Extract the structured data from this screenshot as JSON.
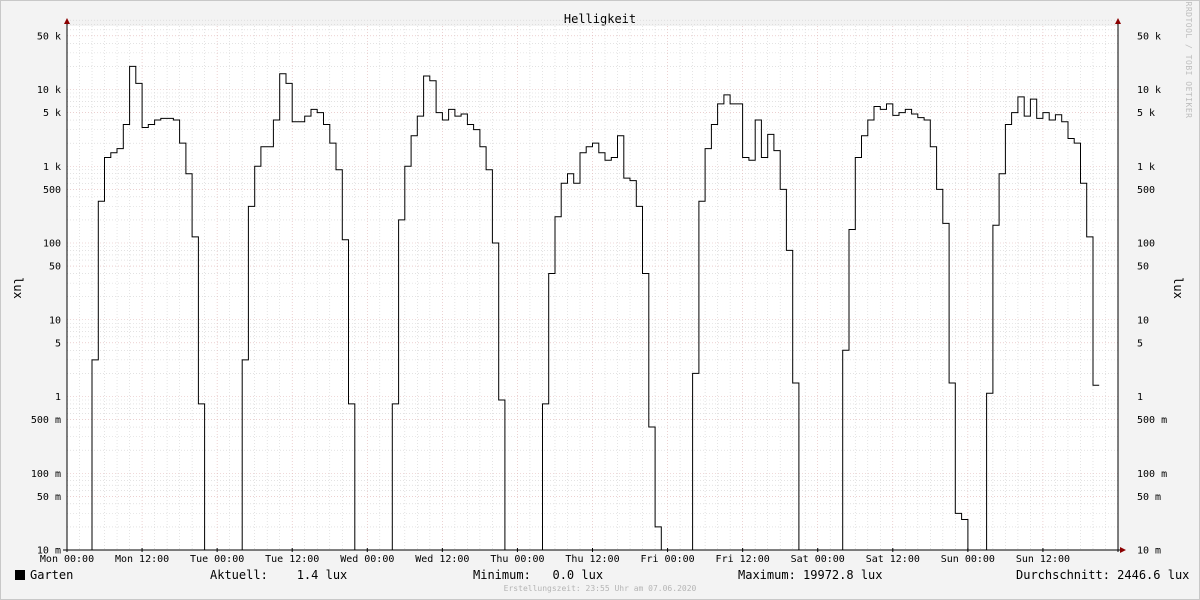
{
  "chart_data": {
    "type": "line",
    "title": "Helligkeit",
    "ylabel": "lux",
    "yscale": "log",
    "ylim": [
      0.01,
      80000
    ],
    "grid": true,
    "y_ticks": [
      {
        "value": 50000,
        "label": "50 k"
      },
      {
        "value": 10000,
        "label": "10 k"
      },
      {
        "value": 5000,
        "label": "5 k"
      },
      {
        "value": 1000,
        "label": "1 k"
      },
      {
        "value": 500,
        "label": "500"
      },
      {
        "value": 100,
        "label": "100"
      },
      {
        "value": 50,
        "label": "50"
      },
      {
        "value": 10,
        "label": "10"
      },
      {
        "value": 5,
        "label": "5"
      },
      {
        "value": 1,
        "label": "1"
      },
      {
        "value": 0.5,
        "label": "500 m"
      },
      {
        "value": 0.1,
        "label": "100 m"
      },
      {
        "value": 0.05,
        "label": "50 m"
      },
      {
        "value": 0.01,
        "label": "10 m"
      }
    ],
    "x_ticks": [
      "Mon 00:00",
      "Mon 12:00",
      "Tue 00:00",
      "Tue 12:00",
      "Wed 00:00",
      "Wed 12:00",
      "Thu 00:00",
      "Thu 12:00",
      "Fri 00:00",
      "Fri 12:00",
      "Sat 00:00",
      "Sat 12:00",
      "Sun 00:00",
      "Sun 12:00"
    ],
    "x_unit": "hours since Mon 00:00",
    "xlim": [
      0,
      168
    ],
    "series": [
      {
        "name": "Garten",
        "color": "#000000",
        "points": [
          [
            0,
            0.01
          ],
          [
            2,
            0.01
          ],
          [
            4,
            0.01
          ],
          [
            4,
            3
          ],
          [
            5,
            3
          ],
          [
            5,
            350
          ],
          [
            6,
            350
          ],
          [
            6,
            1300
          ],
          [
            7,
            1300
          ],
          [
            7,
            1500
          ],
          [
            8,
            1500
          ],
          [
            8,
            1700
          ],
          [
            9,
            1700
          ],
          [
            9,
            3500
          ],
          [
            10,
            3500
          ],
          [
            10,
            20000
          ],
          [
            11,
            20000
          ],
          [
            11,
            12000
          ],
          [
            12,
            12000
          ],
          [
            12,
            3200
          ],
          [
            13,
            3200
          ],
          [
            13,
            3500
          ],
          [
            14,
            3500
          ],
          [
            14,
            4000
          ],
          [
            15,
            4000
          ],
          [
            15,
            4200
          ],
          [
            17,
            4200
          ],
          [
            17,
            4000
          ],
          [
            18,
            4000
          ],
          [
            18,
            2000
          ],
          [
            19,
            2000
          ],
          [
            19,
            800
          ],
          [
            20,
            800
          ],
          [
            20,
            120
          ],
          [
            21,
            120
          ],
          [
            21,
            0.8
          ],
          [
            22,
            0.8
          ],
          [
            22,
            0.01
          ],
          [
            26,
            0.01
          ],
          [
            28,
            0.01
          ],
          [
            28,
            3
          ],
          [
            29,
            3
          ],
          [
            29,
            300
          ],
          [
            30,
            300
          ],
          [
            30,
            1000
          ],
          [
            31,
            1000
          ],
          [
            31,
            1800
          ],
          [
            33,
            1800
          ],
          [
            33,
            4000
          ],
          [
            34,
            4000
          ],
          [
            34,
            16000
          ],
          [
            35,
            16000
          ],
          [
            35,
            12000
          ],
          [
            36,
            12000
          ],
          [
            36,
            3800
          ],
          [
            38,
            3800
          ],
          [
            38,
            4500
          ],
          [
            39,
            4500
          ],
          [
            39,
            5500
          ],
          [
            40,
            5500
          ],
          [
            40,
            5000
          ],
          [
            41,
            5000
          ],
          [
            41,
            3500
          ],
          [
            42,
            3500
          ],
          [
            42,
            2000
          ],
          [
            43,
            2000
          ],
          [
            43,
            900
          ],
          [
            44,
            900
          ],
          [
            44,
            110
          ],
          [
            45,
            110
          ],
          [
            45,
            0.8
          ],
          [
            46,
            0.8
          ],
          [
            46,
            0.01
          ],
          [
            50,
            0.01
          ],
          [
            52,
            0.01
          ],
          [
            52,
            0.8
          ],
          [
            53,
            0.8
          ],
          [
            53,
            200
          ],
          [
            54,
            200
          ],
          [
            54,
            1000
          ],
          [
            55,
            1000
          ],
          [
            55,
            2500
          ],
          [
            56,
            2500
          ],
          [
            56,
            4500
          ],
          [
            57,
            4500
          ],
          [
            57,
            15000
          ],
          [
            58,
            15000
          ],
          [
            58,
            13000
          ],
          [
            59,
            13000
          ],
          [
            59,
            5000
          ],
          [
            60,
            5000
          ],
          [
            60,
            4000
          ],
          [
            61,
            4000
          ],
          [
            61,
            5500
          ],
          [
            62,
            5500
          ],
          [
            62,
            4500
          ],
          [
            63,
            4500
          ],
          [
            63,
            4800
          ],
          [
            64,
            4800
          ],
          [
            64,
            3500
          ],
          [
            65,
            3500
          ],
          [
            65,
            3000
          ],
          [
            66,
            3000
          ],
          [
            66,
            1800
          ],
          [
            67,
            1800
          ],
          [
            67,
            900
          ],
          [
            68,
            900
          ],
          [
            68,
            100
          ],
          [
            69,
            100
          ],
          [
            69,
            0.9
          ],
          [
            70,
            0.9
          ],
          [
            70,
            0.01
          ],
          [
            74,
            0.01
          ],
          [
            76,
            0.01
          ],
          [
            76,
            0.8
          ],
          [
            77,
            0.8
          ],
          [
            77,
            40
          ],
          [
            78,
            40
          ],
          [
            78,
            220
          ],
          [
            79,
            220
          ],
          [
            79,
            600
          ],
          [
            80,
            600
          ],
          [
            80,
            800
          ],
          [
            81,
            800
          ],
          [
            81,
            600
          ],
          [
            82,
            600
          ],
          [
            82,
            1500
          ],
          [
            83,
            1500
          ],
          [
            83,
            1800
          ],
          [
            84,
            1800
          ],
          [
            84,
            2000
          ],
          [
            85,
            2000
          ],
          [
            85,
            1500
          ],
          [
            86,
            1500
          ],
          [
            86,
            1200
          ],
          [
            87,
            1200
          ],
          [
            87,
            1300
          ],
          [
            88,
            1300
          ],
          [
            88,
            2500
          ],
          [
            89,
            2500
          ],
          [
            89,
            700
          ],
          [
            90,
            700
          ],
          [
            90,
            650
          ],
          [
            91,
            650
          ],
          [
            91,
            300
          ],
          [
            92,
            300
          ],
          [
            92,
            40
          ],
          [
            93,
            40
          ],
          [
            93,
            0.4
          ],
          [
            94,
            0.4
          ],
          [
            94,
            0.02
          ],
          [
            95,
            0.02
          ],
          [
            95,
            0.01
          ],
          [
            99,
            0.01
          ],
          [
            100,
            0.01
          ],
          [
            100,
            2
          ],
          [
            101,
            2
          ],
          [
            101,
            350
          ],
          [
            102,
            350
          ],
          [
            102,
            1700
          ],
          [
            103,
            1700
          ],
          [
            103,
            3500
          ],
          [
            104,
            3500
          ],
          [
            104,
            6500
          ],
          [
            105,
            6500
          ],
          [
            105,
            8500
          ],
          [
            106,
            8500
          ],
          [
            106,
            6500
          ],
          [
            108,
            6500
          ],
          [
            108,
            1300
          ],
          [
            109,
            1300
          ],
          [
            109,
            1200
          ],
          [
            110,
            1200
          ],
          [
            110,
            4000
          ],
          [
            111,
            4000
          ],
          [
            111,
            1300
          ],
          [
            112,
            1300
          ],
          [
            112,
            2600
          ],
          [
            113,
            2600
          ],
          [
            113,
            1600
          ],
          [
            114,
            1600
          ],
          [
            114,
            500
          ],
          [
            115,
            500
          ],
          [
            115,
            80
          ],
          [
            116,
            80
          ],
          [
            116,
            1.5
          ],
          [
            117,
            1.5
          ],
          [
            117,
            0.01
          ],
          [
            121,
            0.01
          ],
          [
            124,
            0.01
          ],
          [
            124,
            4
          ],
          [
            125,
            4
          ],
          [
            125,
            150
          ],
          [
            126,
            150
          ],
          [
            126,
            1300
          ],
          [
            127,
            1300
          ],
          [
            127,
            2500
          ],
          [
            128,
            2500
          ],
          [
            128,
            4000
          ],
          [
            129,
            4000
          ],
          [
            129,
            6000
          ],
          [
            130,
            6000
          ],
          [
            130,
            5500
          ],
          [
            131,
            5500
          ],
          [
            131,
            6500
          ],
          [
            132,
            6500
          ],
          [
            132,
            4600
          ],
          [
            133,
            4600
          ],
          [
            133,
            5000
          ],
          [
            134,
            5000
          ],
          [
            134,
            5500
          ],
          [
            135,
            5500
          ],
          [
            135,
            4800
          ],
          [
            136,
            4800
          ],
          [
            136,
            4300
          ],
          [
            137,
            4300
          ],
          [
            137,
            4000
          ],
          [
            138,
            4000
          ],
          [
            138,
            1800
          ],
          [
            139,
            1800
          ],
          [
            139,
            500
          ],
          [
            140,
            500
          ],
          [
            140,
            180
          ],
          [
            141,
            180
          ],
          [
            141,
            1.5
          ],
          [
            142,
            1.5
          ],
          [
            142,
            0.03
          ],
          [
            143,
            0.03
          ],
          [
            143,
            0.025
          ],
          [
            144,
            0.025
          ],
          [
            144,
            0.01
          ],
          [
            147,
            0.01
          ],
          [
            147,
            0.01
          ],
          [
            147,
            1.1
          ],
          [
            148,
            1.1
          ],
          [
            148,
            170
          ],
          [
            149,
            170
          ],
          [
            149,
            800
          ],
          [
            150,
            800
          ],
          [
            150,
            3500
          ],
          [
            151,
            3500
          ],
          [
            151,
            5000
          ],
          [
            152,
            5000
          ],
          [
            152,
            8000
          ],
          [
            153,
            8000
          ],
          [
            153,
            4500
          ],
          [
            154,
            4500
          ],
          [
            154,
            7500
          ],
          [
            155,
            7500
          ],
          [
            155,
            4200
          ],
          [
            156,
            4200
          ],
          [
            156,
            5000
          ],
          [
            157,
            5000
          ],
          [
            157,
            4000
          ],
          [
            158,
            4000
          ],
          [
            158,
            4700
          ],
          [
            159,
            4700
          ],
          [
            159,
            3800
          ],
          [
            160,
            3800
          ],
          [
            160,
            2300
          ],
          [
            161,
            2300
          ],
          [
            161,
            2000
          ],
          [
            162,
            2000
          ],
          [
            162,
            600
          ],
          [
            163,
            600
          ],
          [
            163,
            120
          ],
          [
            164,
            120
          ],
          [
            164,
            1.4
          ],
          [
            165,
            1.4
          ]
        ]
      }
    ]
  },
  "legend": {
    "series_name": "Garten",
    "current_label": "Aktuell:",
    "current_value": "1.4 lux",
    "min_label": "Minimum:",
    "min_value": "0.0 lux",
    "max_label": "Maximum:",
    "max_value": "19972.8 lux",
    "avg_label": "Durchschnitt:",
    "avg_value": "2446.6 lux"
  },
  "watermark": "RRDTOOL / TOBI OETIKER",
  "footer": "Erstellungszeit: 23:55 Uhr am 07.06.2020",
  "colors": {
    "background": "#f3f3f3",
    "plot_background": "#ffffff",
    "major_grid": "#e0b4b4",
    "minor_grid": "#d2d2d2",
    "axis_arrow": "#8b0000",
    "line": "#000000"
  }
}
